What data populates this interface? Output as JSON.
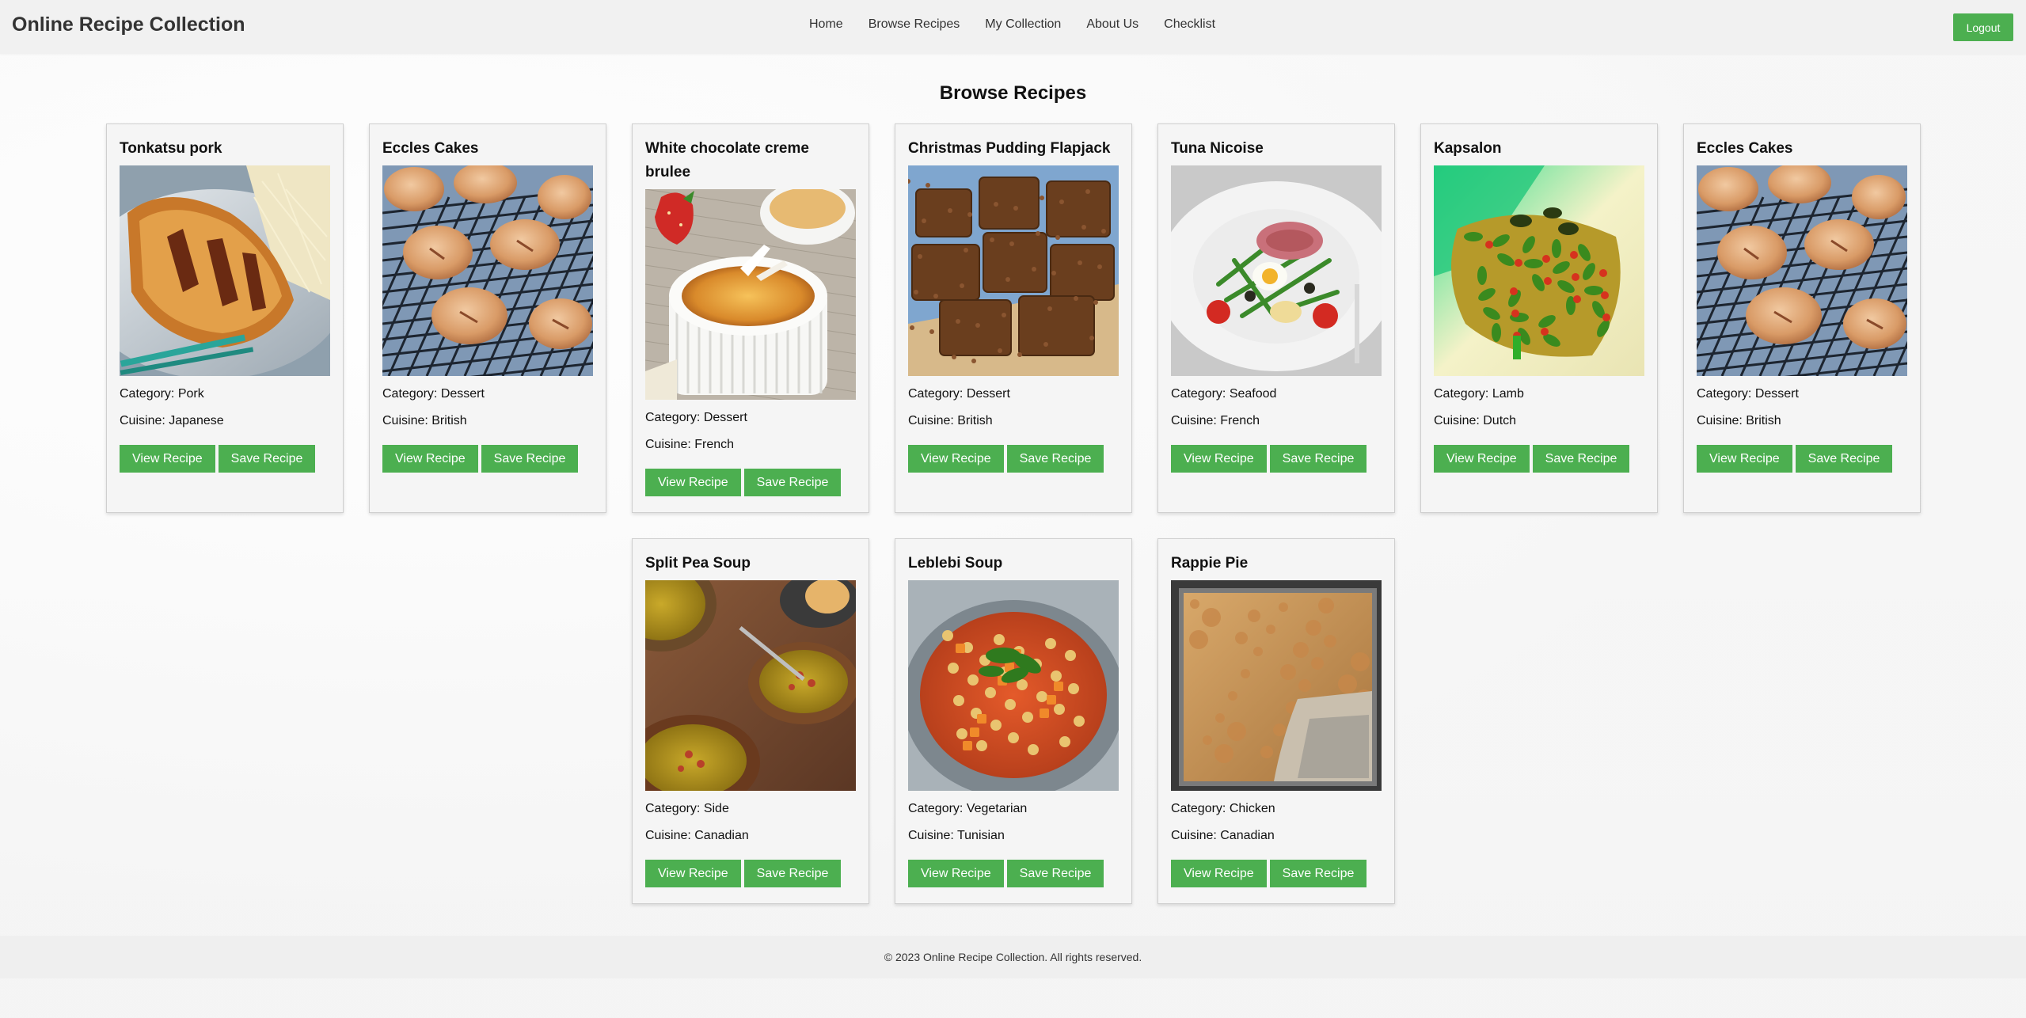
{
  "header": {
    "brand": "Online Recipe Collection",
    "nav": [
      "Home",
      "Browse Recipes",
      "My Collection",
      "About Us",
      "Checklist"
    ],
    "logout_label": "Logout"
  },
  "page_title": "Browse Recipes",
  "labels": {
    "category_prefix": "Category: ",
    "cuisine_prefix": "Cuisine: ",
    "view_button": "View Recipe",
    "save_button": "Save Recipe"
  },
  "recipes": [
    {
      "name": "Tonkatsu pork",
      "category": "Pork",
      "cuisine": "Japanese",
      "image": "tonkatsu-pork-photo"
    },
    {
      "name": "Eccles Cakes",
      "category": "Dessert",
      "cuisine": "British",
      "image": "eccles-cakes-photo"
    },
    {
      "name": "White chocolate creme brulee",
      "category": "Dessert",
      "cuisine": "French",
      "image": "creme-brulee-photo"
    },
    {
      "name": "Christmas Pudding Flapjack",
      "category": "Dessert",
      "cuisine": "British",
      "image": "flapjack-photo"
    },
    {
      "name": "Tuna Nicoise",
      "category": "Seafood",
      "cuisine": "French",
      "image": "tuna-nicoise-photo"
    },
    {
      "name": "Kapsalon",
      "category": "Lamb",
      "cuisine": "Dutch",
      "image": "kapsalon-photo"
    },
    {
      "name": "Eccles Cakes",
      "category": "Dessert",
      "cuisine": "British",
      "image": "eccles-cakes-photo"
    },
    {
      "name": "Split Pea Soup",
      "category": "Side",
      "cuisine": "Canadian",
      "image": "split-pea-soup-photo"
    },
    {
      "name": "Leblebi Soup",
      "category": "Vegetarian",
      "cuisine": "Tunisian",
      "image": "leblebi-soup-photo"
    },
    {
      "name": "Rappie Pie",
      "category": "Chicken",
      "cuisine": "Canadian",
      "image": "rappie-pie-photo"
    }
  ],
  "footer": "© 2023 Online Recipe Collection. All rights reserved.",
  "colors": {
    "accent": "#4caf50",
    "header_bg": "#f0f0f0",
    "card_bg": "#f4f4f4"
  }
}
